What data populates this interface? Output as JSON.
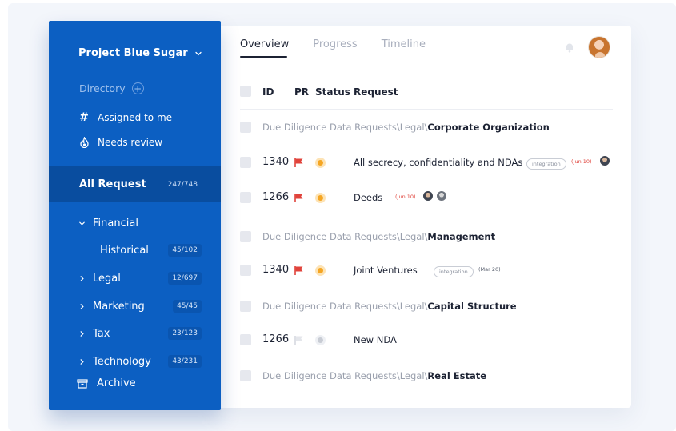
{
  "sidebar": {
    "project_name": "Project Blue Sugar",
    "directory_label": "Directory",
    "quick": [
      {
        "label": "Assigned to me",
        "icon": "hash-icon"
      },
      {
        "label": "Needs review",
        "icon": "flame-icon"
      }
    ],
    "all_request": {
      "label": "All Request",
      "count": "247/748"
    },
    "categories": [
      {
        "label": "Financial",
        "expanded": true,
        "count": ""
      },
      {
        "label": "Historical",
        "sub": true,
        "count": "45/102"
      },
      {
        "label": "Legal",
        "count": "12/697"
      },
      {
        "label": "Marketing",
        "count": "45/45"
      },
      {
        "label": "Tax",
        "count": "23/123"
      },
      {
        "label": "Technology",
        "count": "43/231"
      }
    ],
    "archive_label": "Archive"
  },
  "tabs": [
    {
      "label": "Overview",
      "active": true
    },
    {
      "label": "Progress",
      "active": false
    },
    {
      "label": "Timeline",
      "active": false
    }
  ],
  "table": {
    "headers": {
      "id": "ID",
      "pr": "PR",
      "status": "Status",
      "request": "Request"
    },
    "groups": [
      {
        "path": "Due Diligence Data Requests\\Legal\\",
        "name": "Corporate Organization",
        "rows": [
          {
            "id": "1340",
            "priority": "high",
            "status": "orange",
            "title": "All secrecy, confidentiality and NDAs",
            "tag": "integration",
            "date": "(Jun 10)"
          },
          {
            "id": "1266",
            "priority": "high",
            "status": "orange",
            "title": "Deeds",
            "date": "(Jun 10)"
          }
        ]
      },
      {
        "path": "Due Diligence Data Requests\\Legal\\",
        "name": "Management",
        "rows": [
          {
            "id": "1340",
            "priority": "high",
            "status": "orange",
            "title": "Joint Ventures",
            "tag": "integration",
            "date": "(Mar 20)"
          }
        ]
      },
      {
        "path": "Due Diligence Data Requests\\Legal\\",
        "name": "Capital Structure",
        "rows": [
          {
            "id": "1266",
            "priority": "low",
            "status": "gray",
            "title": "New NDA"
          }
        ]
      },
      {
        "path": "Due Diligence Data Requests\\Legal\\",
        "name": "Real Estate",
        "rows": []
      }
    ]
  },
  "colors": {
    "sidebar": "#0c5fc2",
    "sidebar_active": "#094d9f",
    "flag_high": "#e0433b",
    "status_orange": "#f5a623"
  }
}
